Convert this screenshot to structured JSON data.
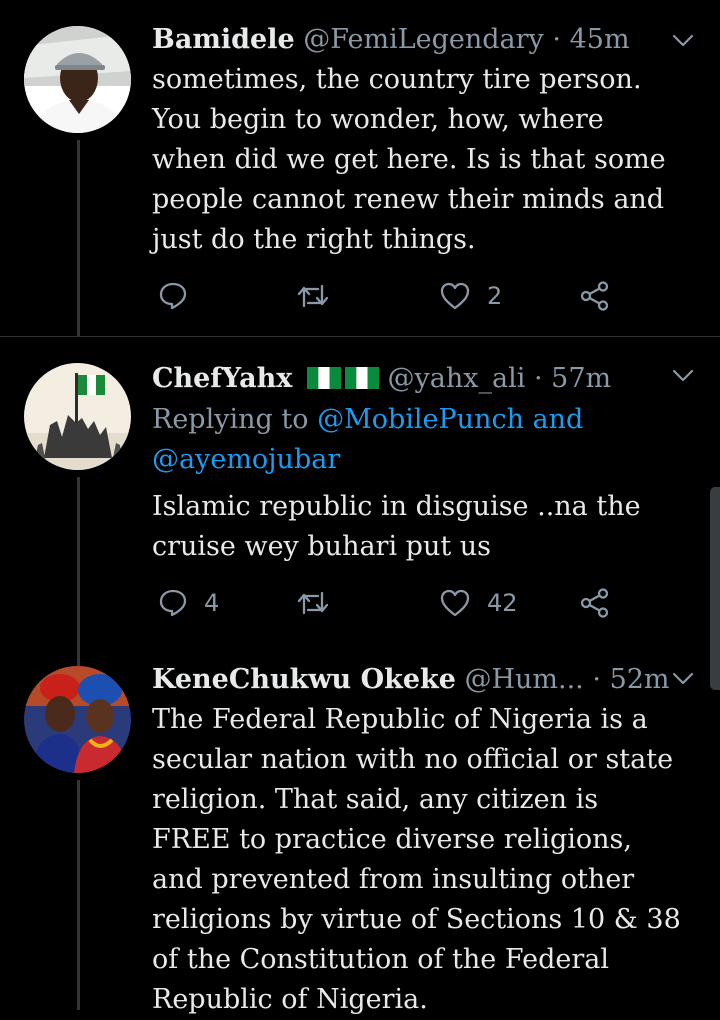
{
  "colors": {
    "background": "#000000",
    "text": "#e7e9ea",
    "secondary": "#8b98a5",
    "link": "#1d9bf0",
    "divider": "#2f3336"
  },
  "tweets": [
    {
      "name": "Bamidele",
      "handle": "@FemiLegendary",
      "separator": "·",
      "time": "45m",
      "lines": [
        "sometimes, the country tire person.",
        "You begin to wonder, how, where",
        "when did we get here. Is is that some",
        "people cannot renew their minds and",
        "just do the right things."
      ],
      "reply_count": "",
      "retweet_count": "",
      "like_count": "2",
      "icons": [
        "reply-icon",
        "retweet-icon",
        "like-icon",
        "share-icon",
        "chevron-down-icon"
      ]
    },
    {
      "name": "ChefYahx",
      "handle": "@yahx_ali",
      "separator": "·",
      "time": "57m",
      "replying_prefix": "Replying to",
      "replying_line1_mention": "@MobilePunch and",
      "replying_line2_mention": "@ayemojubar",
      "lines": [
        "Islamic republic in disguise ..na the",
        "cruise wey buhari put us"
      ],
      "reply_count": "4",
      "retweet_count": "",
      "like_count": "42",
      "icons": [
        "nigeria-flag-icon",
        "nigeria-flag-icon",
        "reply-icon",
        "retweet-icon",
        "like-icon",
        "share-icon",
        "chevron-down-icon"
      ]
    },
    {
      "name": "KeneChukwu Okeke",
      "handle": "@Hum...",
      "separator": "·",
      "time": "52m",
      "lines": [
        "The Federal Republic of Nigeria is a",
        "secular nation with no official or state",
        "religion. That said, any citizen is",
        "FREE to practice diverse religions,",
        "and prevented from insulting other",
        "religions by virtue of Sections 10 & 38",
        "of the Constitution of the Federal",
        "Republic of Nigeria."
      ],
      "icons": [
        "chevron-down-icon"
      ]
    }
  ]
}
